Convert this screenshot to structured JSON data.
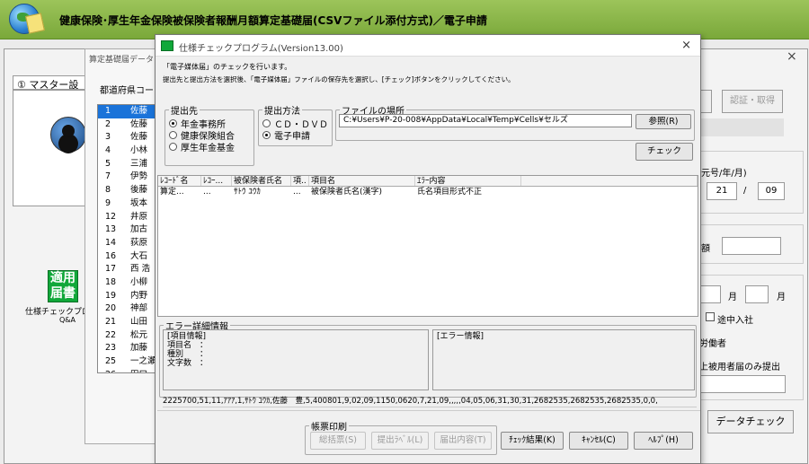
{
  "app": {
    "title": "健康保険･厚生年金保険被保険者報酬月額算定基礎届(CSVファイル添付方式)／電子申請"
  },
  "bg_window": {
    "tab_label": "① マスター設",
    "close_glyph": "×",
    "stamp_text": [
      "適用",
      "届書"
    ],
    "stamp_label": "仕様チェックプロ",
    "qa": "Q&A"
  },
  "sub_window": {
    "title": "算定基礎届データ",
    "pref_label": "都道府県コード",
    "rows": [
      {
        "num": "1",
        "name": "佐藤"
      },
      {
        "num": "2",
        "name": "佐藤"
      },
      {
        "num": "3",
        "name": "佐藤"
      },
      {
        "num": "4",
        "name": "小林"
      },
      {
        "num": "5",
        "name": "三浦"
      },
      {
        "num": "7",
        "name": "伊勢"
      },
      {
        "num": "8",
        "name": "後藤"
      },
      {
        "num": "9",
        "name": "坂本"
      },
      {
        "num": "12",
        "name": "井原"
      },
      {
        "num": "13",
        "name": "加古"
      },
      {
        "num": "14",
        "name": "荻原"
      },
      {
        "num": "16",
        "name": "大石"
      },
      {
        "num": "17",
        "name": "西 浩"
      },
      {
        "num": "18",
        "name": "小柳"
      },
      {
        "num": "19",
        "name": "内野"
      },
      {
        "num": "20",
        "name": "神部"
      },
      {
        "num": "21",
        "name": "山田"
      },
      {
        "num": "22",
        "name": "松元"
      },
      {
        "num": "23",
        "name": "加藤"
      },
      {
        "num": "25",
        "name": "一之瀬"
      },
      {
        "num": "26",
        "name": "田口"
      }
    ]
  },
  "right_panel": {
    "auth_button": "認証・取得",
    "era_label": "元号/年/月)",
    "year": "21",
    "slash": "/",
    "month": "09",
    "amount_label": "額",
    "month_unit_1": "月",
    "month_unit_2": "月",
    "mid_join_label": "途中入社",
    "worker_label": "労働者",
    "insured_only_label": "上被用者届のみ提出",
    "data_check_button": "データチェック"
  },
  "dialog": {
    "title": "仕様チェックプログラム(Version13.00)",
    "close_glyph": "×",
    "instruction1": "「電子媒体届」のチェックを行います。",
    "instruction2": "提出先と提出方法を選択後、「電子媒体届」ファイルの保存先を選択し、[チェック]ボタンをクリックしてください。",
    "dest": {
      "legend": "提出先",
      "options": [
        "年金事務所",
        "健康保険組合",
        "厚生年金基金"
      ],
      "selected": 0
    },
    "method": {
      "legend": "提出方法",
      "options": [
        "ＣＤ・ＤＶＤ",
        "電子申請"
      ],
      "selected": 1
    },
    "file": {
      "legend": "ファイルの場所",
      "path": "C:¥Users¥P-20-008¥AppData¥Local¥Temp¥Cells¥セルズ",
      "browse_button": "参照(R)"
    },
    "check_button": "チェック",
    "grid": {
      "headers": [
        "ﾚｺｰﾄﾞ名",
        "ﾚｺｰ...",
        "被保険者氏名",
        "項..",
        "項目名",
        "ｴﾗｰ内容",
        ""
      ],
      "rows": [
        [
          "算定...",
          "...",
          "ｻﾄｳ ﾕｳｶ",
          "...",
          "被保険者氏名(漢字)",
          "氏名項目形式不正",
          ""
        ]
      ]
    },
    "error_detail": {
      "legend": "エラー詳細情報",
      "item_info": "[項目情報]\n項目名　：\n種別　　：\n文字数　：",
      "error_info": "[エラー情報]"
    },
    "csv_line": "2225700,51,11,ｱｱｱ,1,ｻﾄｳ ﾕｳｶ,佐藤　豊,5,400801,9,02,09,1150,0620,7,21,09,,,,,04,05,06,31,30,31,2682535,2682535,2682535,0,0,",
    "print": {
      "legend": "帳票印刷",
      "buttons": [
        "総括票(S)",
        "提出ﾗﾍﾞﾙ(L)",
        "届出内容(T)"
      ]
    },
    "bottom_buttons": [
      "ﾁｪｯｸ結果(K)",
      "ｷｬﾝｾﾙ(C)",
      "ﾍﾙﾌﾟ(H)"
    ]
  }
}
